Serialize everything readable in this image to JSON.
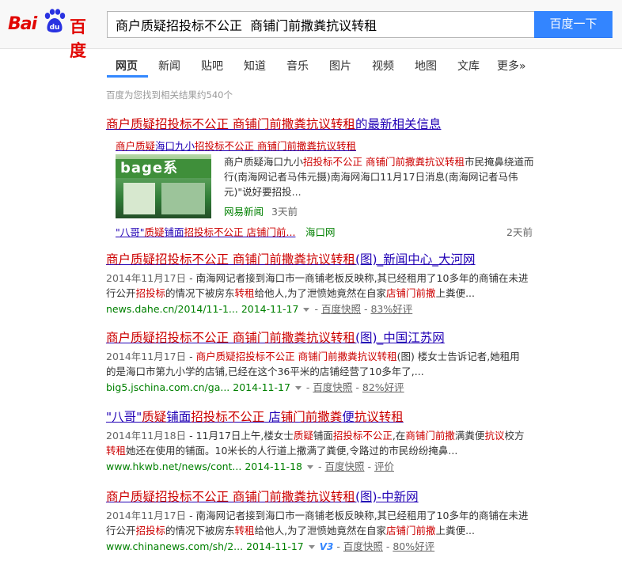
{
  "logo": {
    "bai": "Bai",
    "du_paw": "du",
    "du": "百度"
  },
  "search": {
    "query": "商户质疑招投标不公正  商铺门前撒粪抗议转租",
    "button": "百度一下"
  },
  "tabs": [
    "网页",
    "新闻",
    "贴吧",
    "知道",
    "音乐",
    "图片",
    "视频",
    "地图",
    "文库",
    "更多»"
  ],
  "result_count": "百度为您找到相关结果约540个",
  "news_block": {
    "title_em": "商户质疑招投标不公正 商铺门前撒粪抗议转租",
    "title_rest": "的最新相关信息",
    "sub1_a": "商户质疑",
    "sub1_b": "海口九小",
    "sub1_c": "招投标不公正 商铺门前撒粪抗议转租",
    "thumb_sign": "bage系",
    "abs_a": "商户质疑",
    "abs_b": "海口九小",
    "abs_c": "招投标不公正 商铺门前撒粪抗议转租",
    "abs_d": "市民掩鼻绕道而行(南海网记者马伟元摄)南海网海口11月17日消息(南海网记者马伟元)\"说好要招投...",
    "source": "网易新闻",
    "ago": "3天前",
    "sub2_a": "\"八哥\"",
    "sub2_b": "质疑",
    "sub2_c": "铺面",
    "sub2_d": "招投标不公正 店铺门前...",
    "sub2_source": "海口网",
    "sub2_ago": "2天前"
  },
  "results": [
    {
      "title_em": "商户质疑招投标不公正 商铺门前撒粪抗议转租",
      "title_rest": "(图)_新闻中心_大河网",
      "date": "2014年11月17日",
      "abs": " - 南海网记者接到海口市一商铺老板反映称,其已经租用了10多年的商铺在未进行公开",
      "abs_em1": "招投标",
      "abs2": "的情况下被房东",
      "abs_em2": "转租",
      "abs3": "给他人,为了泄愤她竟然在自家",
      "abs_em3": "店铺门前撒",
      "abs4": "上粪便...",
      "url": "news.dahe.cn/2014/11-1...",
      "urldate": "2014-11-17",
      "snapshot": "百度快照",
      "rating": "83%好评"
    },
    {
      "title_em": "商户质疑招投标不公正 商铺门前撒粪抗议转租",
      "title_rest": "(图)_中国江苏网",
      "date": "2014年11月17日",
      "abs": " - ",
      "abs_em1": "商户质疑招投标不公正 商铺门前撒粪抗议转租",
      "abs2": "(图) 楼女士告诉记者,她租用的是海口市第九小学的店铺,已经在这个36平米的店铺经营了10多年了,...",
      "url": "big5.jschina.com.cn/ga...",
      "urldate": "2014-11-17",
      "snapshot": "百度快照",
      "rating": "82%好评"
    },
    {
      "title_a": "\"八哥\"",
      "title_em1": "质疑",
      "title_b": "铺面",
      "title_em2": "招投标不公正",
      "title_c": " 店",
      "title_em3": "铺门前撒粪",
      "title_d": "便",
      "title_em4": "抗议转租",
      "date": "2014年11月18日",
      "abs": " - 11月17日上午,楼女士",
      "abs_em1": "质疑",
      "abs2": "铺面",
      "abs_em2": "招投标不公正",
      "abs3": ",在",
      "abs_em3": "商铺门前撒",
      "abs4": "满粪便",
      "abs_em4": "抗议",
      "abs5": "校方",
      "abs_em5": "转租",
      "abs6": "她还在使用的铺面。10米长的人行道上撒满了粪便,令路过的市民纷纷掩鼻...",
      "url": "www.hkwb.net/news/cont...",
      "urldate": "2014-11-18",
      "snapshot": "百度快照",
      "rating": "评价"
    },
    {
      "title_em": "商户质疑招投标不公正 商铺门前撒粪抗议转租",
      "title_rest": "(图)-中新网",
      "date": "2014年11月17日",
      "abs": " - 南海网记者接到海口市一商铺老板反映称,其已经租用了10多年的商铺在未进行公开",
      "abs_em1": "招投标",
      "abs2": "的情况下被房东",
      "abs_em2": "转租",
      "abs3": "给他人,为了泄愤她竟然在自家",
      "abs_em3": "店铺门前撒",
      "abs4": "上粪便...",
      "url": "www.chinanews.com/sh/2...",
      "urldate": "2014-11-17",
      "v3": "V3",
      "snapshot": "百度快照",
      "rating": "80%好评"
    }
  ],
  "colors": {
    "accent": "#3385ff",
    "link": "#2100b5",
    "highlight": "#cc0000",
    "url": "#008000"
  }
}
